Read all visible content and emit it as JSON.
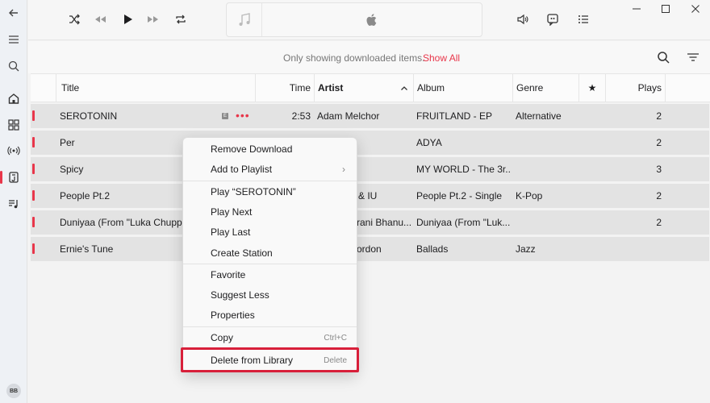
{
  "colors": {
    "accent": "#e8364a",
    "highlight": "#d81f3a"
  },
  "sidebar": {
    "icons": [
      "back-arrow-icon",
      "menu-icon",
      "search-icon",
      "home-icon",
      "browse-icon",
      "radio-icon",
      "library-icon",
      "playlist-icon"
    ],
    "avatar_initials": "BB"
  },
  "topbar": {
    "controls": [
      "shuffle-icon",
      "previous-icon",
      "play-icon",
      "next-icon",
      "repeat-icon"
    ],
    "right_controls": [
      "volume-icon",
      "lyrics-icon",
      "queue-icon"
    ],
    "window_controls": [
      "minimize-icon",
      "maximize-icon",
      "close-icon"
    ]
  },
  "filter": {
    "message": "Only showing downloaded items.",
    "link": "Show All"
  },
  "table": {
    "columns": {
      "title": "Title",
      "time": "Time",
      "artist": "Artist",
      "album": "Album",
      "genre": "Genre",
      "favorite": "★",
      "plays": "Plays"
    },
    "rows": [
      {
        "title": "SEROTONIN",
        "time": "2:53",
        "artist": "Adam Melchor",
        "album": "FRUITLAND - EP",
        "genre": "Alternative",
        "plays": "2",
        "explicit": "E",
        "more": "•••"
      },
      {
        "title": "Per",
        "time": "",
        "artist": "",
        "album": "ADYA",
        "genre": "",
        "plays": "2"
      },
      {
        "title": "Spicy",
        "time": "",
        "artist": "",
        "album": "MY WORLD - The 3r...",
        "genre": "",
        "plays": "3"
      },
      {
        "title": "People Pt.2",
        "time": "",
        "artist": "& IU",
        "album": "People Pt.2 - Single",
        "genre": "K-Pop",
        "plays": "2"
      },
      {
        "title": "Duniyaa (From \"Luka Chuppi\"",
        "time": "",
        "artist": "rani Bhanu...",
        "album": "Duniyaa (From \"Luk...",
        "genre": "",
        "plays": "2"
      },
      {
        "title": "Ernie's Tune",
        "time": "",
        "artist": "ordon",
        "album": "Ballads",
        "genre": "Jazz",
        "plays": ""
      }
    ]
  },
  "context_menu": {
    "items": [
      {
        "label": "Remove Download"
      },
      {
        "label": "Add to Playlist",
        "submenu": "›"
      },
      {
        "label": "Play “SEROTONIN”"
      },
      {
        "label": "Play Next"
      },
      {
        "label": "Play Last"
      },
      {
        "label": "Create Station"
      },
      {
        "label": "Favorite"
      },
      {
        "label": "Suggest Less"
      },
      {
        "label": "Properties"
      },
      {
        "label": "Copy",
        "shortcut": "Ctrl+C"
      },
      {
        "label": "Delete from Library",
        "shortcut": "Delete"
      }
    ]
  }
}
